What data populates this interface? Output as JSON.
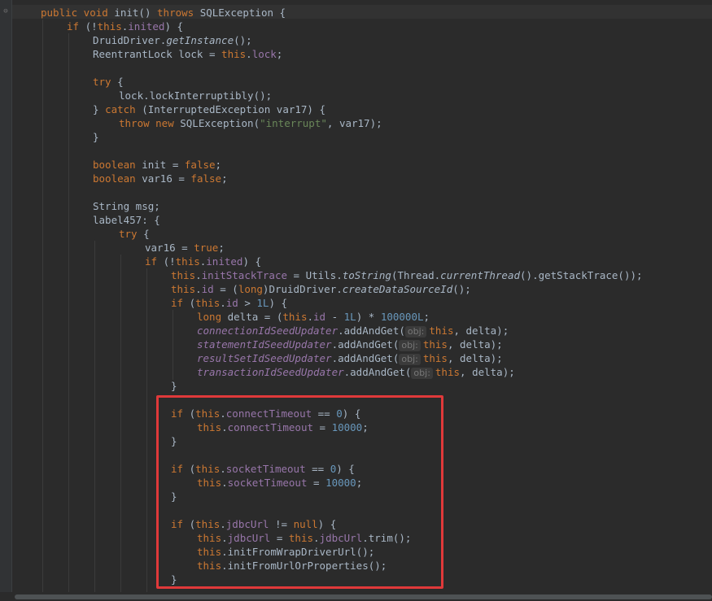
{
  "editor": {
    "fold_marker_glyph": "⊖",
    "code": {
      "l01": {
        "kw1": "public void",
        "t1": " init() ",
        "kw2": "throws",
        "t2": " SQLException {"
      },
      "l02": {
        "kw1": "if",
        "t1": " (!",
        "kw2": "this",
        "t2": ".",
        "f1": "inited",
        "t3": ") {"
      },
      "l03": {
        "t1": "DruidDriver.",
        "m1": "getInstance",
        "t2": "();"
      },
      "l04": {
        "t1": "ReentrantLock lock = ",
        "kw1": "this",
        "t2": ".",
        "f1": "lock",
        "t3": ";"
      },
      "l05": {
        "kw1": "try",
        "t1": " {"
      },
      "l06": {
        "t1": "lock.lockInterruptibly();"
      },
      "l07": {
        "t1": "} ",
        "kw1": "catch",
        "t2": " (InterruptedException var17) {"
      },
      "l08": {
        "kw1": "throw new",
        "t1": " SQLException(",
        "s1": "\"interrupt\"",
        "t2": ", var17);"
      },
      "l09": {
        "t1": "}"
      },
      "l10": {
        "kw1": "boolean",
        "t1": " init = ",
        "kw2": "false",
        "t2": ";"
      },
      "l11": {
        "kw1": "boolean",
        "t1": " var16 = ",
        "kw2": "false",
        "t2": ";"
      },
      "l12": {
        "t1": "String msg;"
      },
      "l13": {
        "t1": "label457: {"
      },
      "l14": {
        "kw1": "try",
        "t1": " {"
      },
      "l15": {
        "t1": "var16 = ",
        "kw1": "true",
        "t2": ";"
      },
      "l16": {
        "kw1": "if",
        "t1": " (!",
        "kw2": "this",
        "t2": ".",
        "f1": "inited",
        "t3": ") {"
      },
      "l17": {
        "kw1": "this",
        "t1": ".",
        "f1": "initStackTrace",
        "t2": " = Utils.",
        "m1": "toString",
        "t3": "(Thread.",
        "m2": "currentThread",
        "t4": "().getStackTrace());"
      },
      "l18": {
        "kw1": "this",
        "t1": ".",
        "f1": "id",
        "t2": " = (",
        "kw2": "long",
        "t3": ")DruidDriver.",
        "m1": "createDataSourceId",
        "t4": "();"
      },
      "l19": {
        "kw1": "if",
        "t1": " (",
        "kw2": "this",
        "t2": ".",
        "f1": "id",
        "t3": " > ",
        "n1": "1L",
        "t4": ") {"
      },
      "l20": {
        "kw1": "long",
        "t1": " delta = (",
        "kw2": "this",
        "t2": ".",
        "f1": "id",
        "t3": " - ",
        "n1": "1L",
        "t4": ") * ",
        "n2": "100000L",
        "t5": ";"
      },
      "l21": {
        "f1": "connectionIdSeedUpdater",
        "t1": ".addAndGet(",
        "h1": "obj:",
        "kw1": "this",
        "t2": ", delta);"
      },
      "l22": {
        "f1": "statementIdSeedUpdater",
        "t1": ".addAndGet(",
        "h1": "obj:",
        "kw1": "this",
        "t2": ", delta);"
      },
      "l23": {
        "f1": "resultSetIdSeedUpdater",
        "t1": ".addAndGet(",
        "h1": "obj:",
        "kw1": "this",
        "t2": ", delta);"
      },
      "l24": {
        "f1": "transactionIdSeedUpdater",
        "t1": ".addAndGet(",
        "h1": "obj:",
        "kw1": "this",
        "t2": ", delta);"
      },
      "l25": {
        "t1": "}"
      },
      "l26": {
        "kw1": "if",
        "t1": " (",
        "kw2": "this",
        "t2": ".",
        "f1": "connectTimeout",
        "t3": " == ",
        "n1": "0",
        "t4": ") {"
      },
      "l27": {
        "kw1": "this",
        "t1": ".",
        "f1": "connectTimeout",
        "t2": " = ",
        "n1": "10000",
        "t3": ";"
      },
      "l28": {
        "t1": "}"
      },
      "l29": {
        "kw1": "if",
        "t1": " (",
        "kw2": "this",
        "t2": ".",
        "f1": "socketTimeout",
        "t3": " == ",
        "n1": "0",
        "t4": ") {"
      },
      "l30": {
        "kw1": "this",
        "t1": ".",
        "f1": "socketTimeout",
        "t2": " = ",
        "n1": "10000",
        "t3": ";"
      },
      "l31": {
        "t1": "}"
      },
      "l32": {
        "kw1": "if",
        "t1": " (",
        "kw2": "this",
        "t2": ".",
        "f1": "jdbcUrl",
        "t3": " != ",
        "kw3": "null",
        "t4": ") {"
      },
      "l33": {
        "kw1": "this",
        "t1": ".",
        "f1": "jdbcUrl",
        "t2": " = ",
        "kw2": "this",
        "t3": ".",
        "f2": "jdbcUrl",
        "t4": ".trim();"
      },
      "l34": {
        "kw1": "this",
        "t1": ".initFromWrapDriverUrl();"
      },
      "l35": {
        "kw1": "this",
        "t1": ".initFromUrlOrProperties();"
      },
      "l36": {
        "t1": "}"
      }
    }
  },
  "colors": {
    "background": "#2b2b2b",
    "keyword": "#cc7832",
    "field": "#9876aa",
    "number": "#6897bb",
    "string": "#6a8759",
    "text": "#a9b7c6",
    "highlight_box": "#e0393a"
  }
}
